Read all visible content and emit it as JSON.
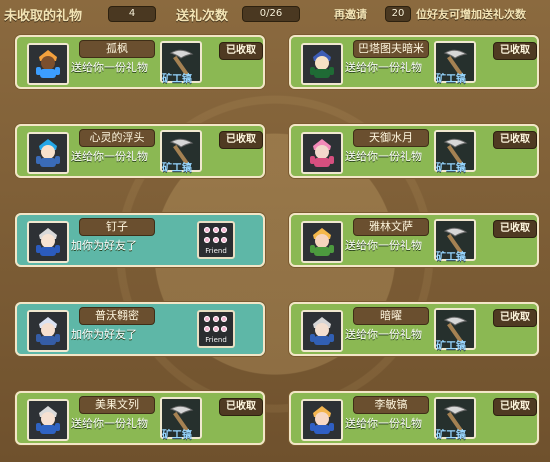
{
  "header": {
    "left_label": "未收取的礼物",
    "left_count": "4",
    "middle_label": "送礼次数",
    "middle_count": "0/26",
    "right_prefix": "再邀请",
    "right_count": "20",
    "right_suffix": "位好友可增加送礼次数"
  },
  "cards": [
    {
      "side": "left",
      "style": "green",
      "name": "孤枫",
      "message": "送给你一份礼物",
      "gift_label": "矿工镐",
      "action": "已收取",
      "icon": "pickaxe-icon"
    },
    {
      "side": "right",
      "style": "green",
      "name": "巴塔图夫暗米",
      "message": "送给你一份礼物",
      "gift_label": "矿工镐",
      "action": "已收取",
      "icon": "pickaxe-icon"
    },
    {
      "side": "left",
      "style": "green",
      "name": "心灵的浮头",
      "message": "送给你一份礼物",
      "gift_label": "矿工镐",
      "action": "已收取",
      "icon": "pickaxe-icon"
    },
    {
      "side": "right",
      "style": "green",
      "name": "天御水月",
      "message": "送给你一份礼物",
      "gift_label": "矿工镐",
      "action": "已收取",
      "icon": "pickaxe-icon"
    },
    {
      "side": "left",
      "style": "cyan",
      "name": "钉子",
      "message": "加你为好友了",
      "gift_label": "Friend",
      "action": "",
      "icon": "friend-icon"
    },
    {
      "side": "right",
      "style": "green",
      "name": "雅林文萨",
      "message": "送给你一份礼物",
      "gift_label": "矿工镐",
      "action": "已收取",
      "icon": "pickaxe-icon"
    },
    {
      "side": "left",
      "style": "cyan",
      "name": "普沃翱密",
      "message": "加你为好友了",
      "gift_label": "Friend",
      "action": "",
      "icon": "friend-icon"
    },
    {
      "side": "right",
      "style": "green",
      "name": "暗曜",
      "message": "送给你一份礼物",
      "gift_label": "矿工镐",
      "action": "已收取",
      "icon": "pickaxe-icon"
    },
    {
      "side": "left",
      "style": "green",
      "name": "美果文列",
      "message": "送给你一份礼物",
      "gift_label": "矿工镐",
      "action": "已收取",
      "icon": "pickaxe-icon"
    },
    {
      "side": "right",
      "style": "green",
      "name": "李敏镐",
      "message": "送给你一份礼物",
      "gift_label": "矿工镐",
      "action": "已收取",
      "icon": "pickaxe-icon"
    }
  ]
}
